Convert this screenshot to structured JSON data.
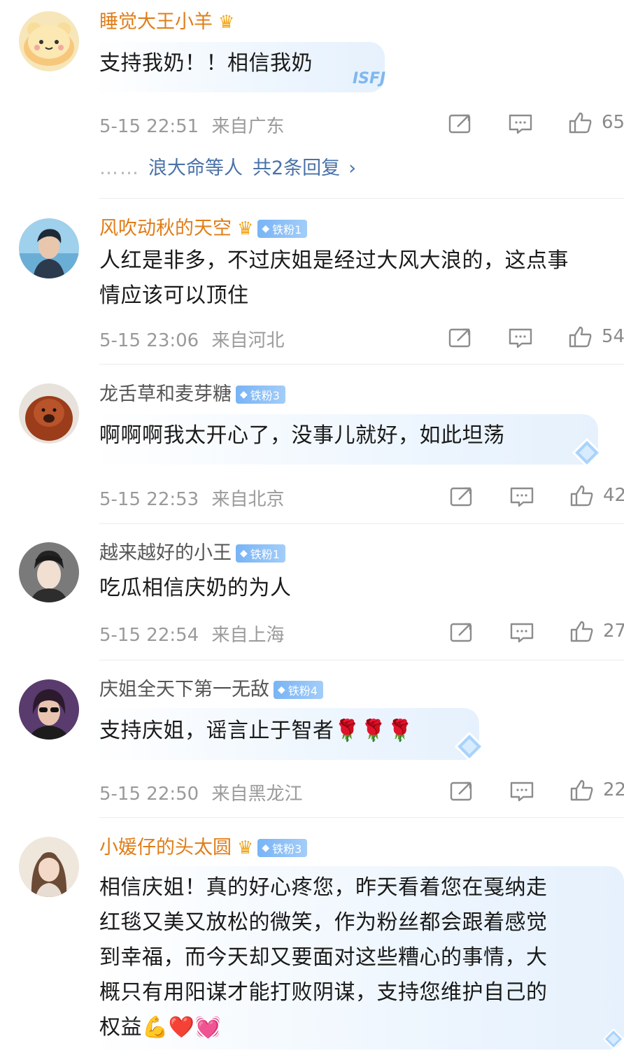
{
  "comments": [
    {
      "username": "睡觉大王小羊",
      "badge": "",
      "text": [
        "支持我奶！！相信我奶"
      ],
      "time": "5-15 22:51",
      "location": "来自广东",
      "likes": "65",
      "replies": {
        "names": "浪大命等人",
        "count": "共2条回复",
        "chevron": "›"
      }
    },
    {
      "username": "风吹动秋的天空",
      "badge": "铁粉1",
      "text": [
        "人红是非多，不过庆姐是经过大风大浪的，这点事",
        "情应该可以顶住"
      ],
      "time": "5-15 23:06",
      "location": "来自河北",
      "likes": "54"
    },
    {
      "username": "龙舌草和麦芽糖",
      "badge": "铁粉3",
      "text": [
        "啊啊啊我太开心了，没事儿就好，如此坦荡"
      ],
      "time": "5-15 22:53",
      "location": "来自北京",
      "likes": "42"
    },
    {
      "username": "越来越好的小王",
      "badge": "铁粉1",
      "text": [
        "吃瓜相信庆奶的为人"
      ],
      "time": "5-15 22:54",
      "location": "来自上海",
      "likes": "27"
    },
    {
      "username": "庆姐全天下第一无敌",
      "badge": "铁粉4",
      "text": [
        "支持庆姐，谣言止于智者🌹🌹🌹"
      ],
      "time": "5-15 22:50",
      "location": "来自黑龙江",
      "likes": "22"
    },
    {
      "username": "小媛仔的头太圆",
      "badge": "铁粉3",
      "text": [
        "相信庆姐！真的好心疼您，昨天看着您在戛纳走",
        "红毯又美又放松的微笑，作为粉丝都会跟着感觉",
        "到幸福，而今天却又要面对这些糟心的事情，大",
        "概只有用阳谋才能打败阴谋，支持您维护自己的",
        "权益💪❤️💓"
      ]
    }
  ],
  "decorations": {
    "sfj": "ISFJ"
  },
  "colors": {
    "vip_name": "#e07d18",
    "plain_name": "#555555",
    "link": "#4a72a8",
    "badge": "#78b4f5",
    "meta": "#9a9a9a"
  },
  "icons": [
    "share-icon",
    "comment-icon",
    "like-icon",
    "crown-icon",
    "diamond-icon"
  ]
}
